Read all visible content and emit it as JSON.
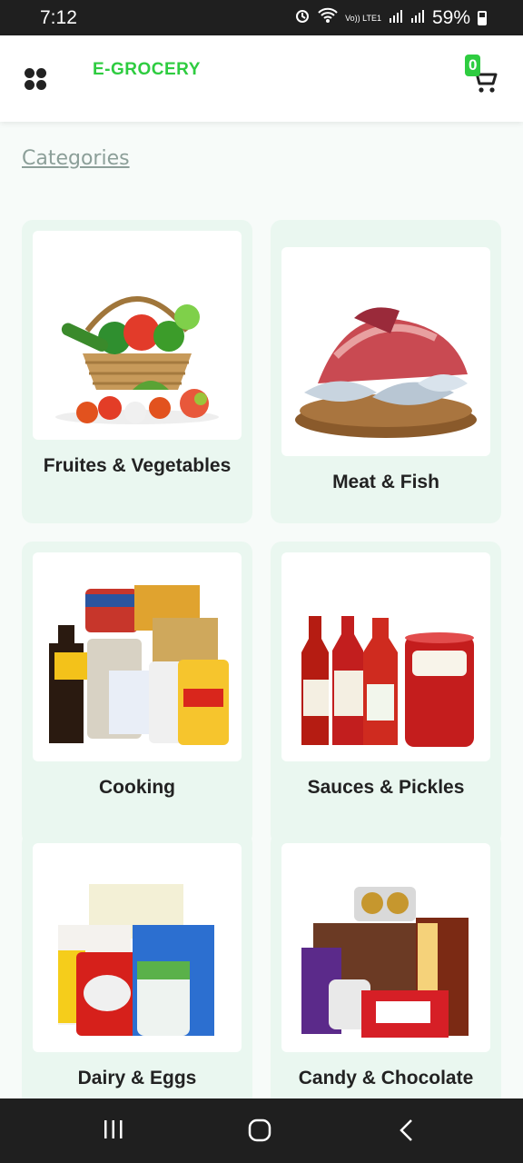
{
  "status": {
    "time": "7:12",
    "network": "Vo)) LTE1",
    "battery": "59%"
  },
  "header": {
    "brand": "E-GROCERY",
    "cart_count": "0"
  },
  "section_title": "Categories",
  "categories": [
    {
      "label": "Fruites & Vegetables",
      "icon": "vegetable-basket-image"
    },
    {
      "label": "Meat & Fish",
      "icon": "meat-fish-image"
    },
    {
      "label": "Cooking",
      "icon": "cooking-products-image"
    },
    {
      "label": "Sauces & Pickles",
      "icon": "sauces-bottles-image"
    },
    {
      "label": "Dairy & Eggs",
      "icon": "dairy-products-image"
    },
    {
      "label": "Candy & Chocolate",
      "icon": "candy-chocolate-image"
    }
  ],
  "colors": {
    "accent": "#2ecc40",
    "card_bg": "#eaf7f0",
    "page_bg": "#f7fbf9"
  }
}
